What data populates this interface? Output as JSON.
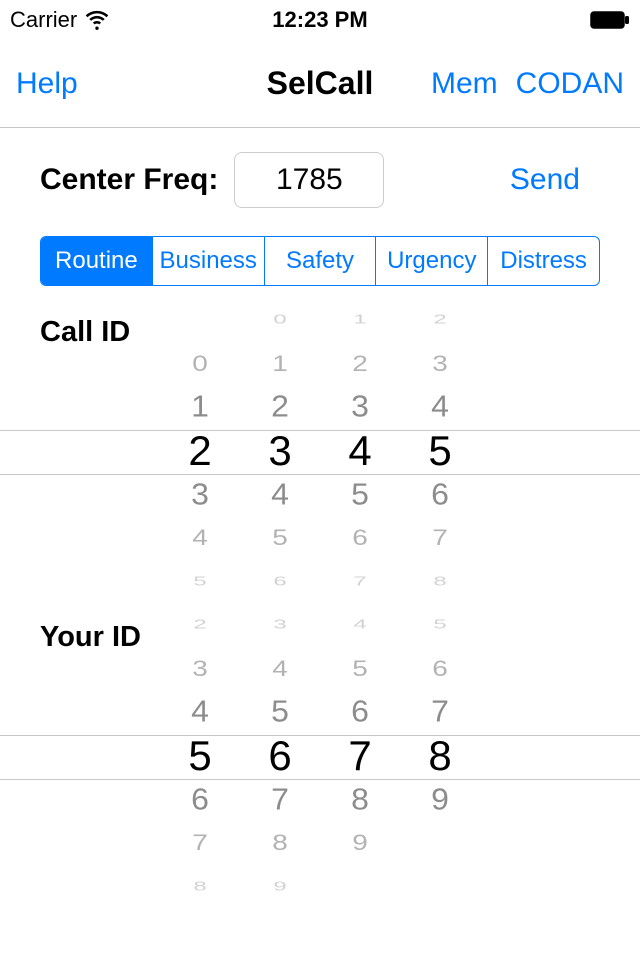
{
  "status": {
    "carrier": "Carrier",
    "time": "12:23 PM"
  },
  "nav": {
    "help": "Help",
    "title": "SelCall",
    "mem": "Mem",
    "codan": "CODAN"
  },
  "freq": {
    "label": "Center Freq:",
    "value": "1785",
    "send": "Send"
  },
  "segments": [
    "Routine",
    "Business",
    "Safety",
    "Urgency",
    "Distress"
  ],
  "segment_selected": 0,
  "call_id": {
    "label": "Call ID",
    "columns": [
      {
        "rows": [
          "",
          "0",
          "1",
          "2",
          "3",
          "4",
          "5"
        ]
      },
      {
        "rows": [
          "0",
          "1",
          "2",
          "3",
          "4",
          "5",
          "6"
        ]
      },
      {
        "rows": [
          "1",
          "2",
          "3",
          "4",
          "5",
          "6",
          "7"
        ]
      },
      {
        "rows": [
          "2",
          "3",
          "4",
          "5",
          "6",
          "7",
          "8"
        ]
      }
    ]
  },
  "your_id": {
    "label": "Your ID",
    "columns": [
      {
        "rows": [
          "2",
          "3",
          "4",
          "5",
          "6",
          "7",
          "8"
        ]
      },
      {
        "rows": [
          "3",
          "4",
          "5",
          "6",
          "7",
          "8",
          "9"
        ]
      },
      {
        "rows": [
          "4",
          "5",
          "6",
          "7",
          "8",
          "9",
          ""
        ]
      },
      {
        "rows": [
          "5",
          "6",
          "7",
          "8",
          "9",
          "",
          ""
        ]
      }
    ]
  }
}
